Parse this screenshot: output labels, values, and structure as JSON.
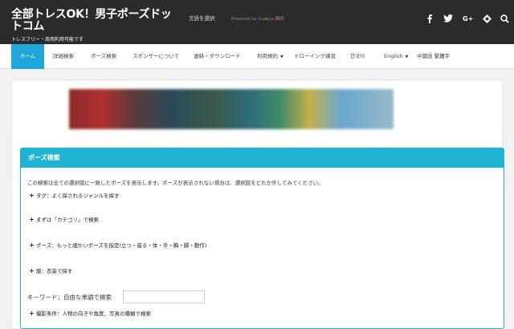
{
  "header": {
    "title": "全部トレスOK！男子ポーズドットコム",
    "subtitle": "トレスフリー・商用利用可能です",
    "language_select": "言語を選択",
    "powered_by": "Powered by",
    "google": [
      "G",
      "o",
      "o",
      "g",
      "l",
      "e"
    ],
    "translate": "翻訳",
    "social": [
      {
        "icon": "facebook-icon",
        "glyph": "f"
      },
      {
        "icon": "twitter-icon",
        "glyph": "🐦"
      },
      {
        "icon": "google-plus-icon",
        "glyph": "G+"
      },
      {
        "icon": "feedly-icon",
        "glyph": "◈"
      },
      {
        "icon": "search-icon",
        "glyph": "⌕"
      }
    ]
  },
  "nav": {
    "items": [
      {
        "label": "ホーム"
      },
      {
        "label": "詳細検索"
      },
      {
        "label": "ポーズ検索"
      },
      {
        "label": "スポンサーについて"
      },
      {
        "label": "連絡・ダウンロード"
      },
      {
        "label": "利用規約"
      },
      {
        "label": "ドローイング練習"
      },
      {
        "label": "한국어"
      },
      {
        "label": "English"
      },
      {
        "label": "中國語 繁體字"
      }
    ]
  },
  "search_panel": {
    "title": "ポーズ検索",
    "description": "この検索は全ての選択肢に一致したポーズを表示します。ポーズが表示されない場合は、選択肢をどれか外してみてください。",
    "sections": [
      {
        "label": "タグ：よく探されるジャンルを探す"
      },
      {
        "label": "まずは「カテゴリ」で検索"
      },
      {
        "label": "ポーズ：もっと細かいポーズを指定(立つ・座る・体・手・胸・脚・動作)"
      },
      {
        "label": "服：衣装で探す"
      }
    ],
    "keyword_label": "キーワード：自由な単語で検索",
    "keyword_value": "",
    "shooting_conditions": "撮影条件：人物の向きや角度、写真の種類で検索"
  }
}
